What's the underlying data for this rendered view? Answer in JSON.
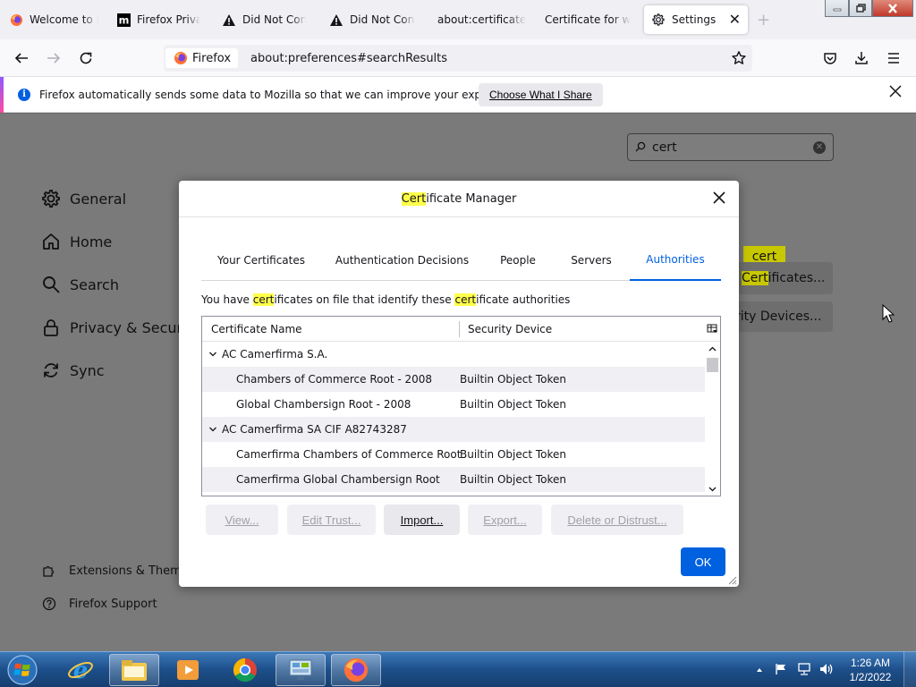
{
  "browser": {
    "tabs": [
      {
        "title": "Welcome to Firefox",
        "icon": "firefox-icon"
      },
      {
        "title": "Firefox Privacy Notice",
        "icon": "mozilla-m-icon"
      },
      {
        "title": "Did Not Connect",
        "icon": "warning-icon"
      },
      {
        "title": "Did Not Connect",
        "icon": "warning-icon"
      },
      {
        "title": "about:certificate",
        "icon": ""
      },
      {
        "title": "Certificate for www",
        "icon": ""
      },
      {
        "title": "Settings",
        "icon": "gear-icon"
      }
    ],
    "identity_label": "Firefox",
    "url": "about:preferences#searchResults"
  },
  "notification": {
    "text": "Firefox automatically sends some data to Mozilla so that we can improve your experience.",
    "button": "Choose What I Share"
  },
  "settings": {
    "search_value": "cert",
    "sidebar": [
      {
        "label": "General",
        "icon": "gear-icon"
      },
      {
        "label": "Home",
        "icon": "home-icon"
      },
      {
        "label": "Search",
        "icon": "search-icon"
      },
      {
        "label": "Privacy & Security",
        "icon": "lock-icon"
      },
      {
        "label": "Sync",
        "icon": "sync-icon"
      }
    ],
    "footer": [
      {
        "label": "Extensions & Themes",
        "icon": "puzzle-icon"
      },
      {
        "label": "Firefox Support",
        "icon": "help-icon"
      }
    ],
    "tooltip": "cert",
    "view_certs_hl": "Cert",
    "view_certs_rest": "ificates...",
    "security_devices": "rity Devices..."
  },
  "dialog": {
    "title_hl": "Cert",
    "title_rest": "ificate Manager",
    "tabs": [
      "Your Certificates",
      "Authentication Decisions",
      "People",
      "Servers",
      "Authorities"
    ],
    "selected_tab": "Authorities",
    "desc": {
      "p1": "You have ",
      "h1": "cert",
      "p2": "ificates on file that identify these ",
      "h2": "cert",
      "p3": "ificate authorities"
    },
    "columns": [
      "Certificate Name",
      "Security Device"
    ],
    "rows": [
      {
        "type": "group",
        "name": "AC Camerfirma S.A.",
        "device": ""
      },
      {
        "type": "item",
        "name": "Chambers of Commerce Root - 2008",
        "device": "Builtin Object Token"
      },
      {
        "type": "item",
        "name": "Global Chambersign Root - 2008",
        "device": "Builtin Object Token"
      },
      {
        "type": "group",
        "name": "AC Camerfirma SA CIF A82743287",
        "device": ""
      },
      {
        "type": "item",
        "name": "Camerfirma Chambers of Commerce Root",
        "device": "Builtin Object Token"
      },
      {
        "type": "item",
        "name": "Camerfirma Global Chambersign Root",
        "device": "Builtin Object Token"
      }
    ],
    "buttons": {
      "view": "View...",
      "edit": "Edit Trust...",
      "import": "Import...",
      "export": "Export...",
      "delete": "Delete or Distrust..."
    },
    "ok": "OK"
  },
  "taskbar": {
    "time": "1:26 AM",
    "date": "1/2/2022"
  },
  "colors": {
    "accent": "#0060df",
    "highlight": "#c8c800",
    "ok_button": "#0061e0"
  }
}
